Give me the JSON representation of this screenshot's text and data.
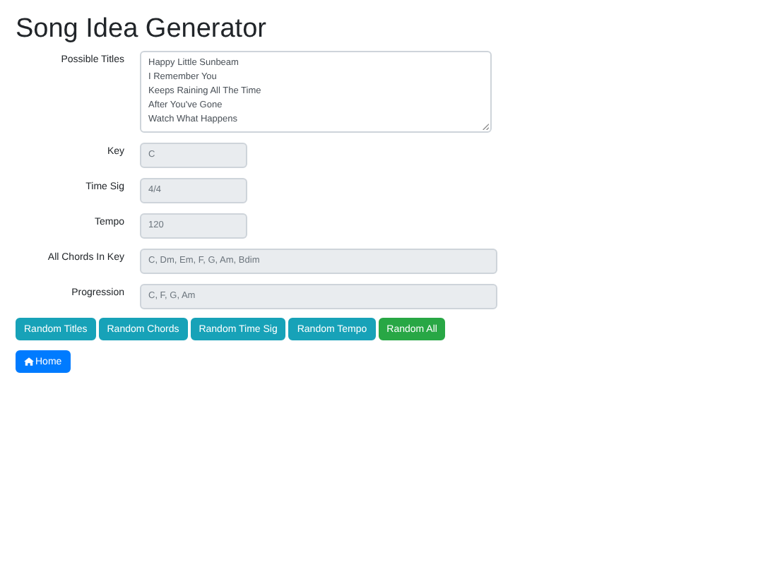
{
  "page": {
    "title": "Song Idea Generator"
  },
  "titles_field": {
    "label": "Possible Titles",
    "lines": [
      "Happy Little Sunbeam",
      "I Remember You",
      "Keeps Raining All The Time",
      "After You've Gone",
      "Watch What Happens"
    ]
  },
  "fields": [
    {
      "label": "Key",
      "value": "C",
      "kind": "short"
    },
    {
      "label": "Time Sig",
      "value": "4/4",
      "kind": "short"
    },
    {
      "label": "Tempo",
      "value": "120",
      "kind": "short"
    },
    {
      "label": "All Chords In Key",
      "value": "C, Dm, Em, F, G, Am, Bdim",
      "kind": "wide"
    },
    {
      "label": "Progression",
      "value": "C, F, G, Am",
      "kind": "wide"
    }
  ],
  "buttons": [
    {
      "label": "Random Titles",
      "kind": "info"
    },
    {
      "label": "Random Chords",
      "kind": "info"
    },
    {
      "label": "Random Time Sig",
      "kind": "info"
    },
    {
      "label": "Random Tempo",
      "kind": "info"
    },
    {
      "label": "Random All",
      "kind": "success"
    }
  ],
  "home_button": {
    "label": "Home"
  }
}
